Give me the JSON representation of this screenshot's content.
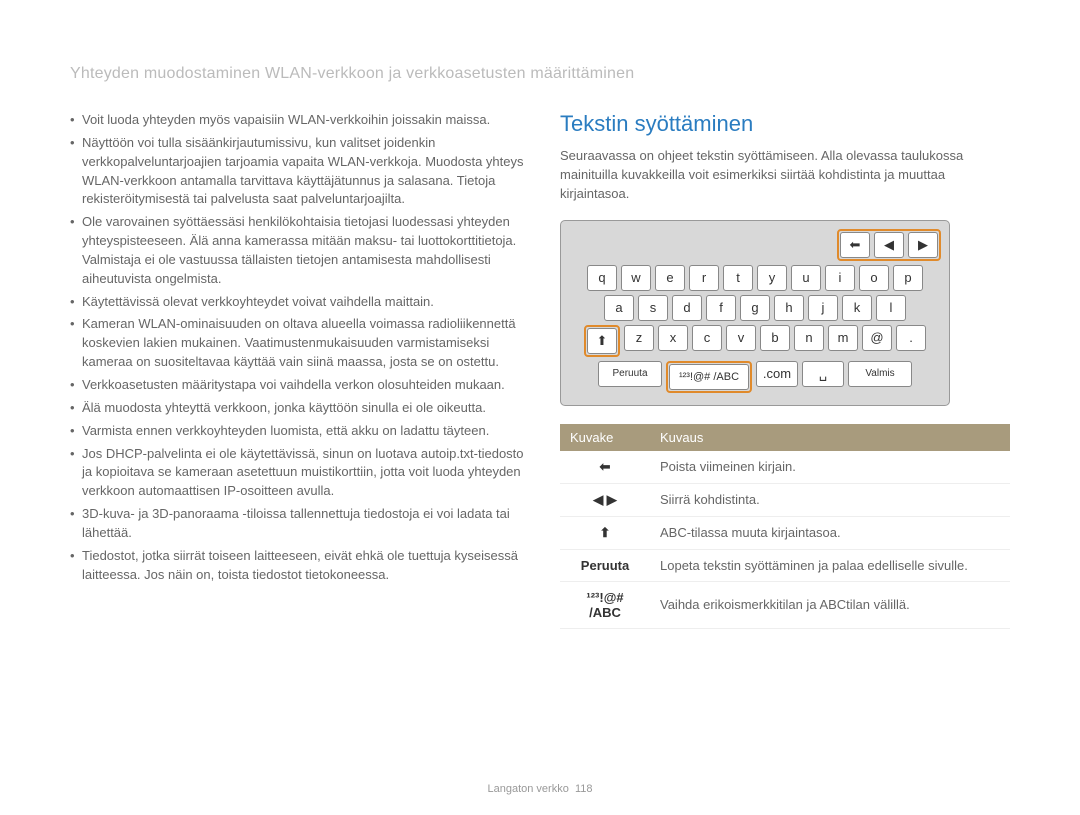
{
  "header": "Yhteyden muodostaminen WLAN-verkkoon ja verkkoasetusten määrittäminen",
  "left_bullets": [
    "Voit luoda yhteyden myös vapaisiin WLAN-verkkoihin joissakin maissa.",
    "Näyttöön voi tulla sisäänkirjautumissivu, kun valitset joidenkin verkkopalveluntarjoajien tarjoamia vapaita WLAN-verkkoja. Muodosta yhteys WLAN-verkkoon antamalla tarvittava käyttäjätunnus ja salasana. Tietoja rekisteröitymisestä tai palvelusta saat palveluntarjoajilta.",
    "Ole varovainen syöttäessäsi henkilökohtaisia tietojasi luodessasi yhteyden yhteyspisteeseen. Älä anna kamerassa mitään maksu- tai luottokorttitietoja. Valmistaja ei ole vastuussa tällaisten tietojen antamisesta mahdollisesti aiheutuvista ongelmista.",
    "Käytettävissä olevat verkkoyhteydet voivat vaihdella maittain.",
    "Kameran WLAN-ominaisuuden on oltava alueella voimassa radioliikennettä koskevien lakien mukainen. Vaatimustenmukaisuuden varmistamiseksi kameraa on suositeltavaa käyttää vain siinä maassa, josta se on ostettu.",
    "Verkkoasetusten määritystapa voi vaihdella verkon olosuhteiden mukaan.",
    "Älä muodosta yhteyttä verkkoon, jonka käyttöön sinulla ei ole oikeutta.",
    "Varmista ennen verkkoyhteyden luomista, että akku on ladattu täyteen.",
    "Jos DHCP-palvelinta ei ole käytettävissä, sinun on luotava autoip.txt-tiedosto ja kopioitava se kameraan asetettuun muistikorttiin, jotta voit luoda yhteyden verkkoon automaattisen IP-osoitteen avulla.",
    "3D-kuva- ja 3D-panoraama -tiloissa tallennettuja tiedostoja ei voi ladata tai lähettää.",
    "Tiedostot, jotka siirrät toiseen laitteeseen, eivät ehkä ole tuettuja kyseisessä laitteessa. Jos näin on, toista tiedostot tietokoneessa."
  ],
  "section_heading": "Tekstin syöttäminen",
  "intro": "Seuraavassa on ohjeet tekstin syöttämiseen. Alla olevassa taulukossa mainituilla kuvakkeilla voit esimerkiksi siirtää kohdistinta ja muuttaa kirjaintasoa.",
  "keyboard": {
    "nav_keys": {
      "back": "⬅",
      "left": "◀",
      "right": "▶"
    },
    "row1": [
      "q",
      "w",
      "e",
      "r",
      "t",
      "y",
      "u",
      "i",
      "o",
      "p"
    ],
    "row2": [
      "a",
      "s",
      "d",
      "f",
      "g",
      "h",
      "j",
      "k",
      "l"
    ],
    "row3": [
      "⬆",
      "z",
      "x",
      "c",
      "v",
      "b",
      "n",
      "m",
      "@",
      "."
    ],
    "bottom": {
      "cancel": "Peruuta",
      "mode": "¹²³!@# /ABC",
      "com": ".com",
      "space": "␣",
      "done": "Valmis"
    }
  },
  "table": {
    "headers": {
      "icon": "Kuvake",
      "desc": "Kuvaus"
    },
    "rows": [
      {
        "icon": "⬅",
        "desc": "Poista viimeinen kirjain."
      },
      {
        "icon": "◀ ▶",
        "desc": "Siirrä kohdistinta."
      },
      {
        "icon": "⬆",
        "desc": "ABC-tilassa muuta kirjaintasoa."
      },
      {
        "icon": "Peruuta",
        "desc": "Lopeta tekstin syöttäminen ja palaa edelliselle sivulle."
      },
      {
        "icon": "¹²³!@# /ABC",
        "desc": "Vaihda erikoismerkkitilan ja ABCtilan välillä."
      }
    ]
  },
  "footer": {
    "text": "Langaton verkko",
    "page": "118"
  }
}
